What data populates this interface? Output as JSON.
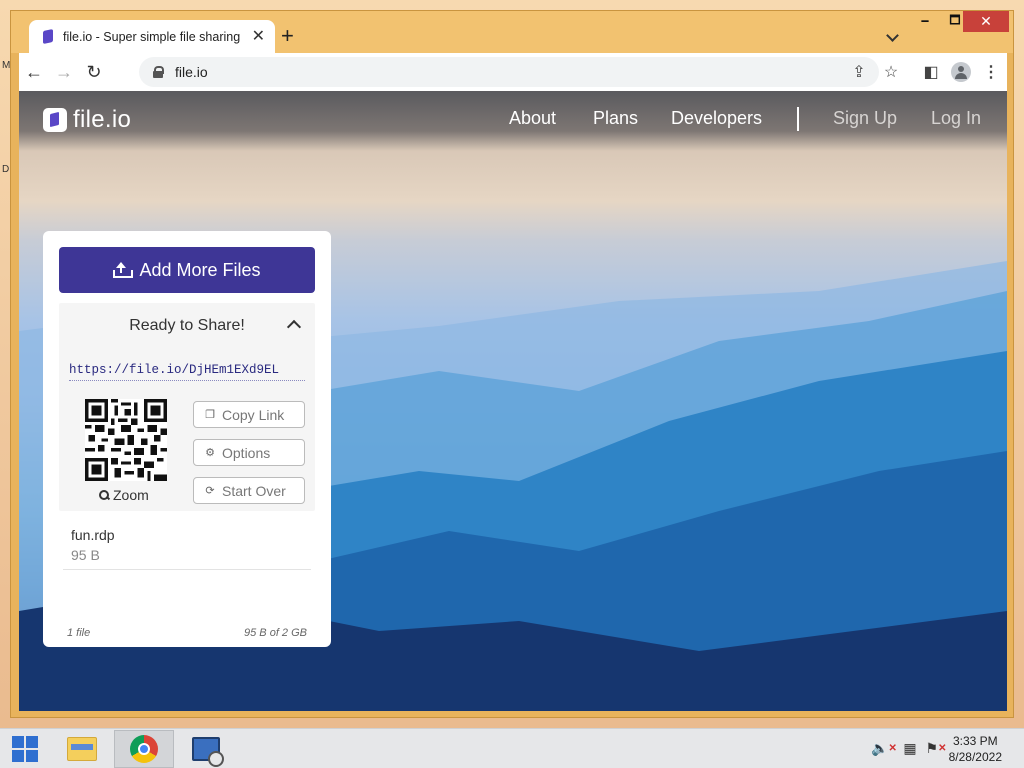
{
  "desktop": {
    "marks": [
      "M",
      "D"
    ]
  },
  "browser": {
    "tab": {
      "title": "file.io - Super simple file sharing",
      "close_label": "✕"
    },
    "new_tab_label": "+",
    "window_controls": {
      "minimize": "🗕",
      "maximize": "🗖",
      "close": "✕"
    },
    "address": {
      "url": "file.io"
    },
    "nav": {
      "back": "←",
      "forward": "→",
      "reload": "↻"
    },
    "toolbar_icons": {
      "share": "⇪",
      "star": "☆",
      "side_panel": "◧",
      "menu": "⋮"
    }
  },
  "site": {
    "logo_text": "file.io",
    "nav": [
      "About",
      "Plans",
      "Developers"
    ],
    "auth": {
      "sign_up": "Sign Up",
      "log_in": "Log In"
    }
  },
  "share_card": {
    "add_button": "Add More Files",
    "ready_title": "Ready to Share!",
    "share_url": "https://file.io/DjHEm1EXd9EL",
    "zoom_label": "Zoom",
    "buttons": {
      "copy_link": "Copy Link",
      "options": "Options",
      "start_over": "Start Over"
    },
    "file": {
      "name": "fun.rdp",
      "size": "95 B"
    },
    "footer": {
      "count": "1 file",
      "storage": "95 B of 2 GB"
    }
  },
  "taskbar": {
    "clock": {
      "time": "3:33 PM",
      "date": "8/28/2022"
    }
  },
  "colors": {
    "primary_button": "#3e3696",
    "window_frame": "#e8b35c",
    "link_text": "#2a2a80"
  }
}
